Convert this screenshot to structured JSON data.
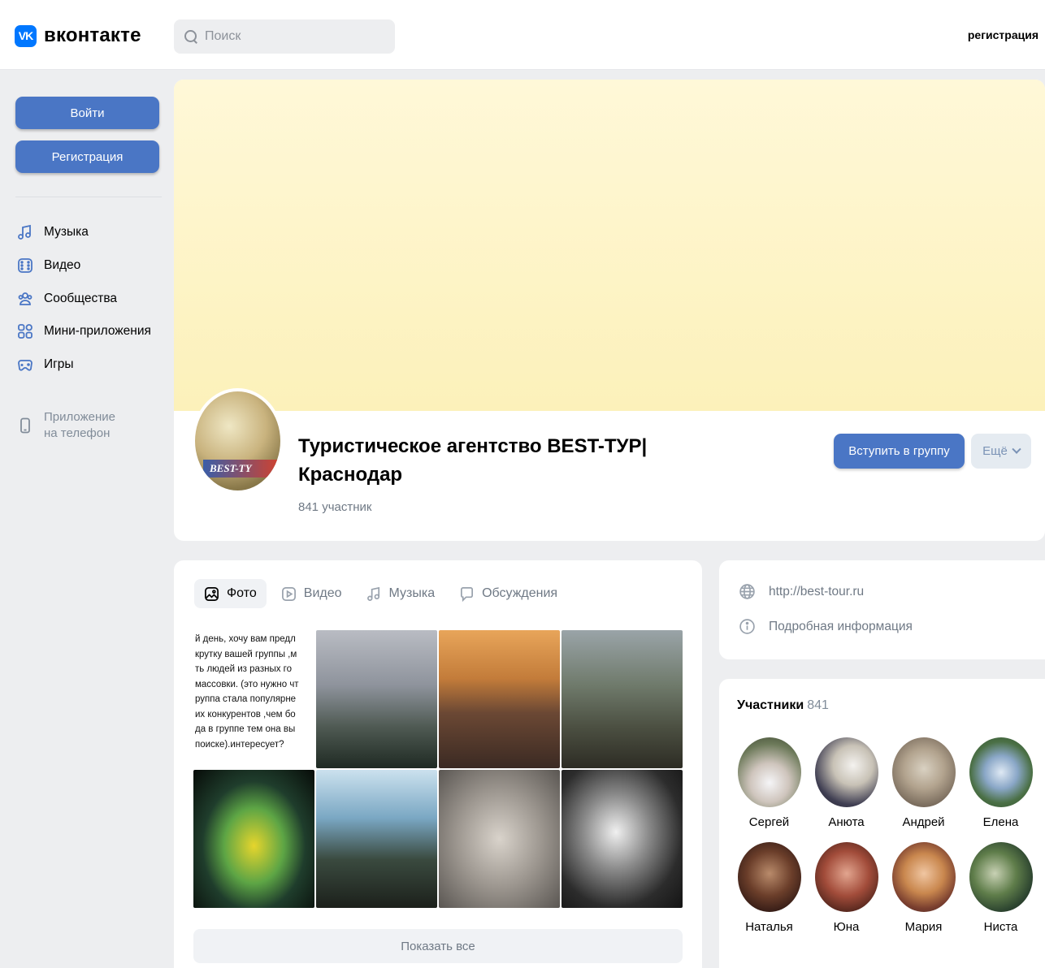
{
  "header": {
    "logo_mark": "VK",
    "logo_text": "вконтакте",
    "search_placeholder": "Поиск",
    "register_link": "регистрация"
  },
  "sidebar": {
    "login_button": "Войти",
    "register_button": "Регистрация",
    "nav": [
      {
        "label": "Музыка",
        "icon": "music-icon"
      },
      {
        "label": "Видео",
        "icon": "video-icon"
      },
      {
        "label": "Сообщества",
        "icon": "communities-icon"
      },
      {
        "label": "Мини-приложения",
        "icon": "mini-apps-icon"
      },
      {
        "label": "Игры",
        "icon": "games-icon"
      }
    ],
    "app_line1": "Приложение",
    "app_line2": "на телефон"
  },
  "group": {
    "avatar_text": "BEST-TY",
    "title": "Туристическое агентство BEST-ТУР| Краснодар",
    "members_count": "841 участник",
    "join_button": "Вступить в группу",
    "more_button": "Ещё"
  },
  "media": {
    "tabs": [
      {
        "label": "Фото",
        "icon": "photo-icon"
      },
      {
        "label": "Видео",
        "icon": "video-icon"
      },
      {
        "label": "Музыка",
        "icon": "music-icon"
      },
      {
        "label": "Обсуждения",
        "icon": "discussion-icon"
      }
    ],
    "text_photo_lines": [
      "й день, хочу вам предл",
      "крутку вашей группы ,м",
      "ть людей из разных го",
      "массовки. (это нужно чт",
      "руппа стала популярне",
      "их конкурентов ,чем бо",
      "да в группе тем она вы",
      "поиске).интересует?"
    ],
    "show_all_button": "Показать все"
  },
  "info": {
    "website": "http://best-tour.ru",
    "details": "Подробная информация"
  },
  "members": {
    "title": "Участники",
    "count": "841",
    "list": [
      "Сергей",
      "Анюта",
      "Андрей",
      "Елена",
      "Наталья",
      "Юна",
      "Мария",
      "Ниста"
    ]
  },
  "colors": {
    "accent": "#4a76c5",
    "page_bg": "#edeef0",
    "cover": "#fcf1ba"
  }
}
